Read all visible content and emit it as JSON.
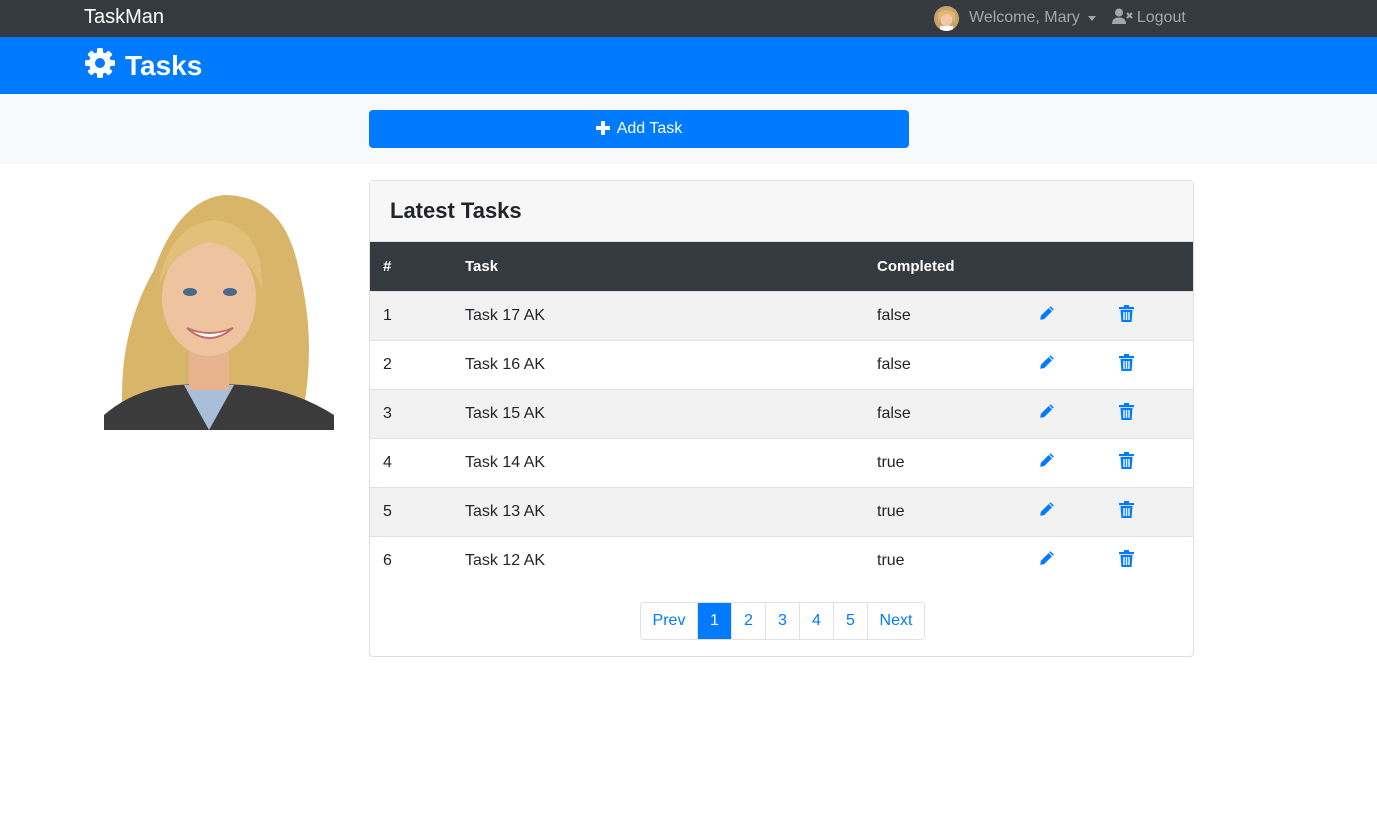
{
  "navbar": {
    "brand": "TaskMan",
    "welcome_label": "Welcome, Mary",
    "logout_label": "Logout"
  },
  "header": {
    "title": "Tasks"
  },
  "actions": {
    "add_task_label": "Add Task"
  },
  "card": {
    "title": "Latest Tasks",
    "columns": [
      "#",
      "Task",
      "Completed",
      "",
      ""
    ],
    "rows": [
      {
        "num": "1",
        "task": "Task 17 AK",
        "completed": "false"
      },
      {
        "num": "2",
        "task": "Task 16 AK",
        "completed": "false"
      },
      {
        "num": "3",
        "task": "Task 15 AK",
        "completed": "false"
      },
      {
        "num": "4",
        "task": "Task 14 AK",
        "completed": "true"
      },
      {
        "num": "5",
        "task": "Task 13 AK",
        "completed": "true"
      },
      {
        "num": "6",
        "task": "Task 12 AK",
        "completed": "true"
      }
    ],
    "row_icons": {
      "edit": "pencil-icon",
      "delete": "trash-icon"
    }
  },
  "pagination": {
    "prev_label": "Prev",
    "pages": [
      "1",
      "2",
      "3",
      "4",
      "5"
    ],
    "active_page": "1",
    "next_label": "Next"
  },
  "colors": {
    "primary": "#007bff",
    "navbar": "#343a40",
    "action_band": "#f8f9fa"
  }
}
